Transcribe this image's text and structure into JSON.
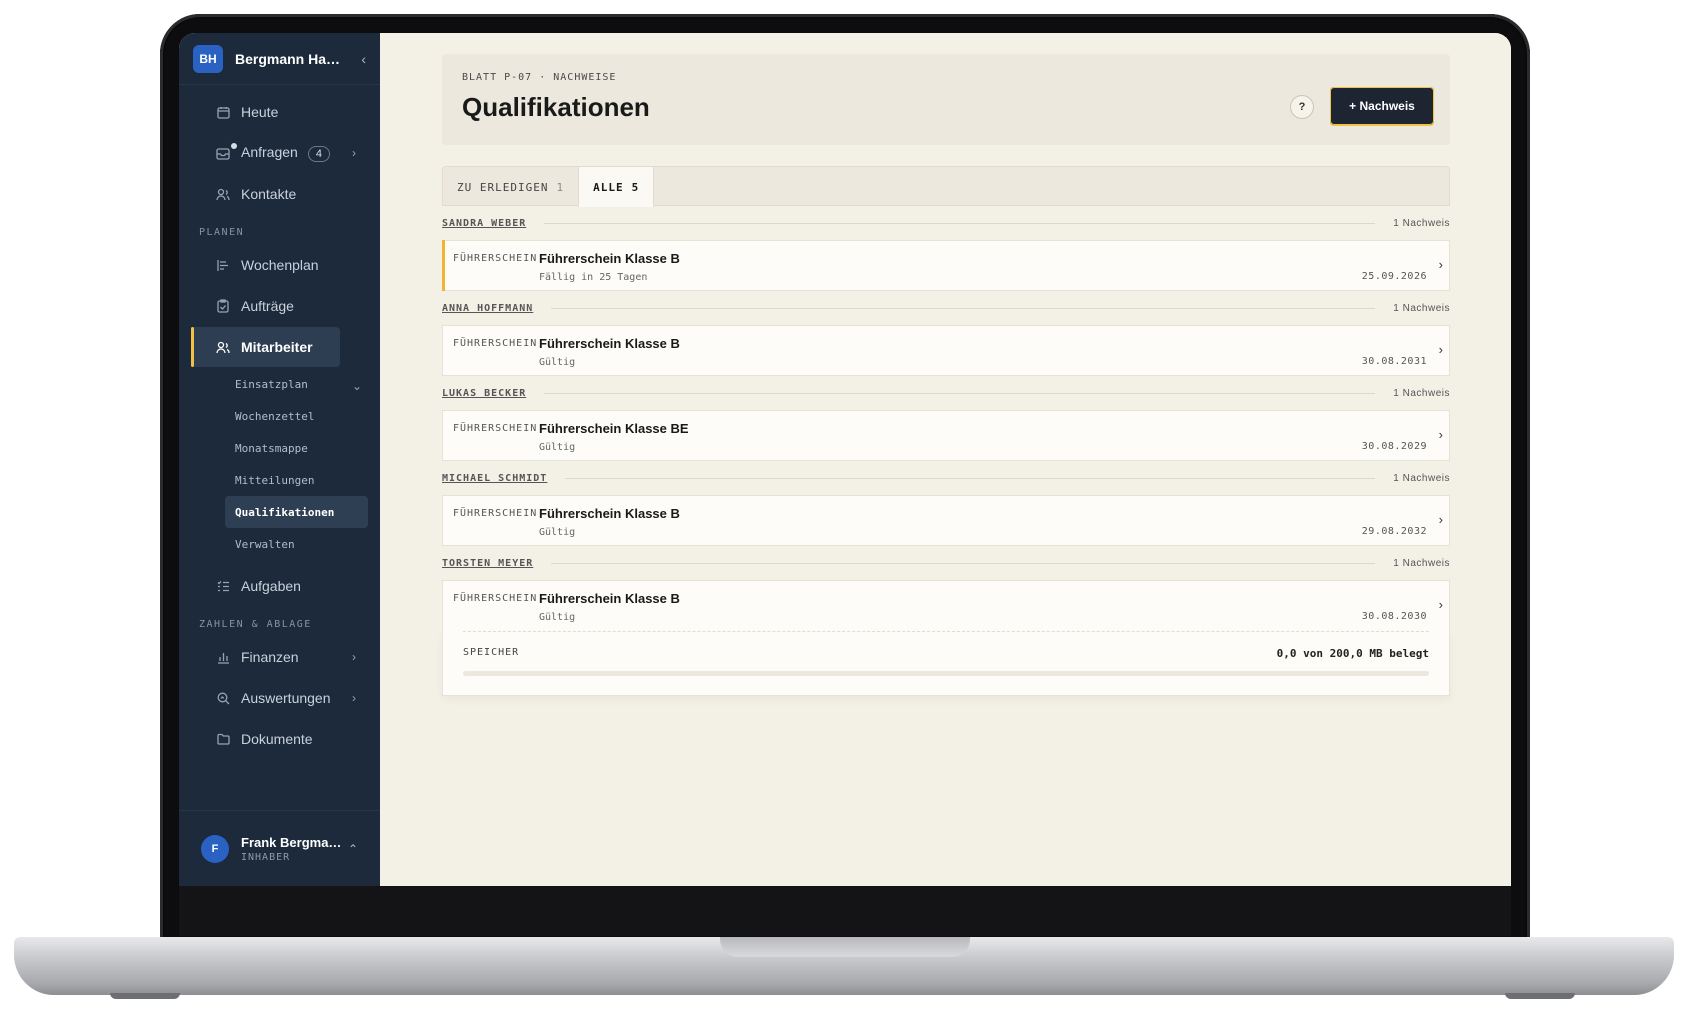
{
  "workspace": {
    "initials": "BH",
    "name": "Bergmann Ha…"
  },
  "nav": {
    "top": [
      {
        "label": "Heute",
        "icon": "calendar-icon"
      },
      {
        "label": "Anfragen",
        "icon": "inbox-icon",
        "badge": "4"
      },
      {
        "label": "Kontakte",
        "icon": "contacts-icon"
      }
    ],
    "planen_label": "PLANEN",
    "planen": [
      {
        "label": "Wochenplan",
        "icon": "gantt-icon"
      },
      {
        "label": "Aufträge",
        "icon": "clipboard-icon"
      },
      {
        "label": "Mitarbeiter",
        "icon": "users-icon"
      }
    ],
    "mitarbeiter_sub": [
      "Einsatzplan",
      "Wochenzettel",
      "Monatsmappe",
      "Mitteilungen",
      "Qualifikationen",
      "Verwalten"
    ],
    "aufgaben": "Aufgaben",
    "zahlen_label": "ZAHLEN & ABLAGE",
    "zahlen": [
      {
        "label": "Finanzen",
        "icon": "bar-chart-icon"
      },
      {
        "label": "Auswertungen",
        "icon": "search-chart-icon"
      },
      {
        "label": "Dokumente",
        "icon": "folder-icon"
      }
    ]
  },
  "user": {
    "initial": "F",
    "name": "Frank Bergma…",
    "role": "INHABER"
  },
  "header": {
    "eyebrow": "BLATT P-07 · NACHWEISE",
    "title": "Qualifikationen",
    "help": "?",
    "add_button": "+ Nachweis"
  },
  "tabs": [
    {
      "label": "ZU ERLEDIGEN",
      "count": "1"
    },
    {
      "label": "ALLE",
      "count": "5"
    }
  ],
  "groups": [
    {
      "name": "SANDRA WEBER",
      "count": "1 Nachweis",
      "item": {
        "category": "FÜHRERSCHEIN",
        "title": "Führerschein Klasse B",
        "status": "Fällig in 25 Tagen",
        "date": "25.09.2026"
      }
    },
    {
      "name": "ANNA HOFFMANN",
      "count": "1 Nachweis",
      "item": {
        "category": "FÜHRERSCHEIN",
        "title": "Führerschein Klasse B",
        "status": "Gültig",
        "date": "30.08.2031"
      }
    },
    {
      "name": "LUKAS BECKER",
      "count": "1 Nachweis",
      "item": {
        "category": "FÜHRERSCHEIN",
        "title": "Führerschein Klasse BE",
        "status": "Gültig",
        "date": "30.08.2029"
      }
    },
    {
      "name": "MICHAEL SCHMIDT",
      "count": "1 Nachweis",
      "item": {
        "category": "FÜHRERSCHEIN",
        "title": "Führerschein Klasse B",
        "status": "Gültig",
        "date": "29.08.2032"
      }
    },
    {
      "name": "TORSTEN MEYER",
      "count": "1 Nachweis",
      "item": {
        "category": "FÜHRERSCHEIN",
        "title": "Führerschein Klasse B",
        "status": "Gültig",
        "date": "30.08.2030"
      }
    }
  ],
  "storage": {
    "label": "SPEICHER",
    "value": "0,0 von 200,0 MB belegt",
    "used_fraction": 0.0
  },
  "colors": {
    "sidebar": "#1c2a3b",
    "accent": "#f2c144",
    "brand_blue": "#2a62c4",
    "page_bg": "#f3f0e6"
  }
}
